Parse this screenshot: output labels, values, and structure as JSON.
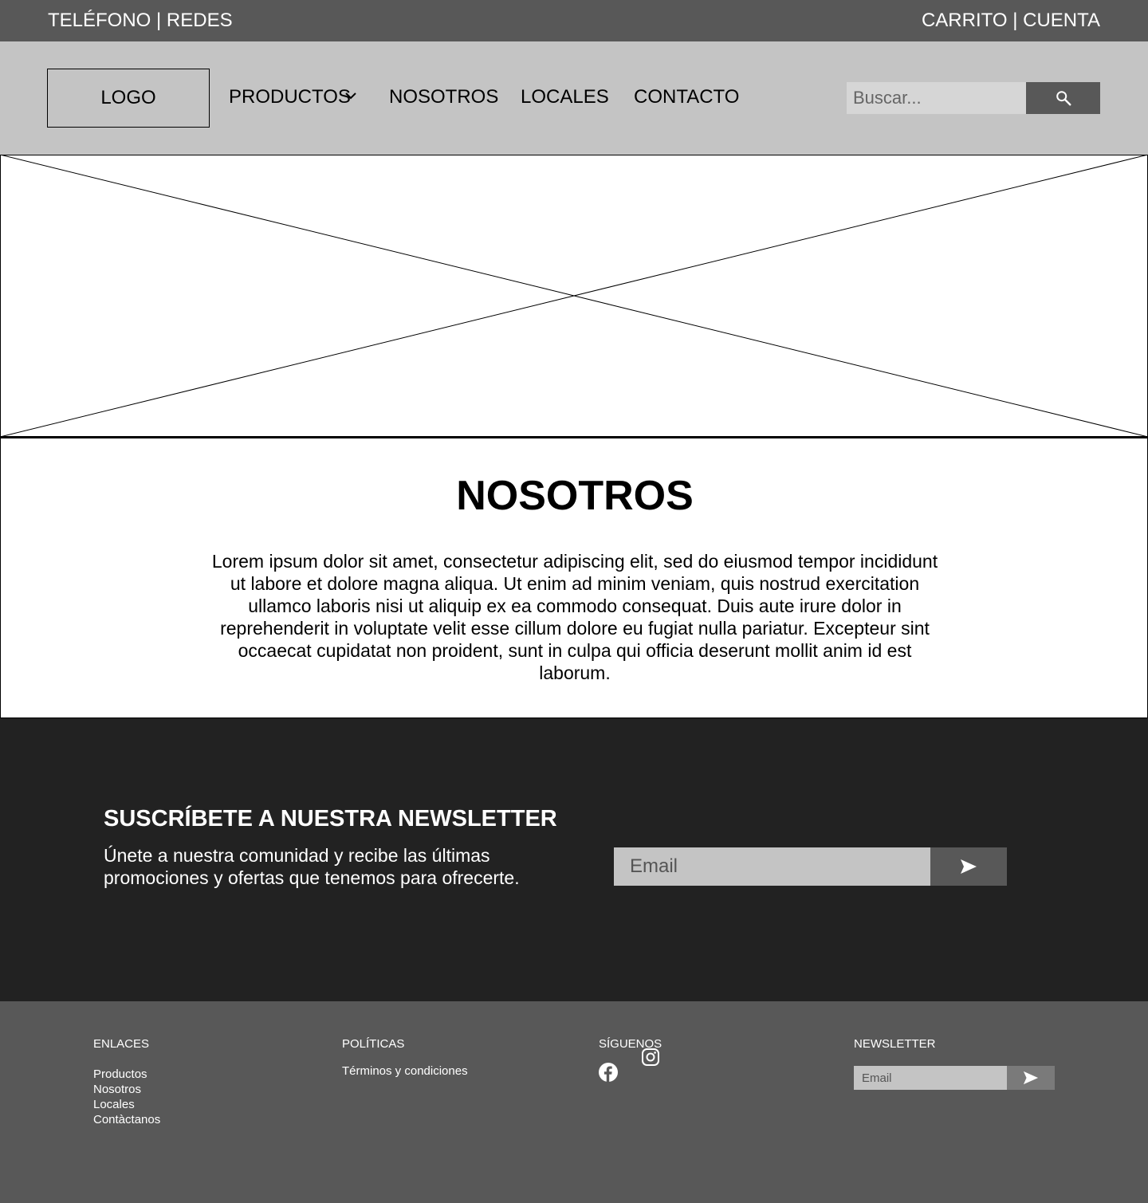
{
  "topbar": {
    "left_text": "TELÉFONO | REDES",
    "right_text": "CARRITO | CUENTA"
  },
  "header": {
    "logo": "LOGO",
    "nav": {
      "productos": "PRODUCTOS",
      "nosotros": "NOSOTROS",
      "locales": "LOCALES",
      "contacto": "CONTACTO"
    },
    "search": {
      "placeholder": "Buscar...",
      "icon": "search-icon"
    }
  },
  "about": {
    "title": "NOSOTROS",
    "body": "Lorem ipsum dolor sit amet, consectetur adipiscing elit, sed do eiusmod tempor incididunt ut labore et dolore magna aliqua. Ut enim ad minim veniam, quis nostrud exercitation ullamco laboris nisi ut aliquip ex ea commodo consequat. Duis aute irure dolor in reprehenderit in voluptate velit esse cillum dolore eu fugiat nulla pariatur. Excepteur sint occaecat cupidatat non proident, sunt in culpa qui officia deserunt mollit anim id est laborum."
  },
  "newsletter": {
    "title": "SUSCRÍBETE A NUESTRA NEWSLETTER",
    "text": "Únete a nuestra comunidad y recibe las últimas promociones y ofertas que tenemos para ofrecerte.",
    "placeholder": "Email",
    "icon": "send-icon"
  },
  "footer": {
    "enlaces": {
      "heading": "ENLACES",
      "links": [
        "Productos",
        "Nosotros",
        "Locales",
        "Contàctanos"
      ]
    },
    "politicas": {
      "heading": "POLÍTICAS",
      "links": [
        "Términos y condiciones"
      ]
    },
    "siguenos": {
      "heading": "SÍGUENOS",
      "icons": [
        "facebook-icon",
        "instagram-icon"
      ]
    },
    "newsletter": {
      "heading": "NEWSLETTER",
      "placeholder": "Email",
      "icon": "send-icon"
    }
  },
  "colors": {
    "topbar_bg": "#585858",
    "header_bg": "#c4c4c4",
    "newsletter_bg": "#222222",
    "footer_bg": "#585858"
  }
}
